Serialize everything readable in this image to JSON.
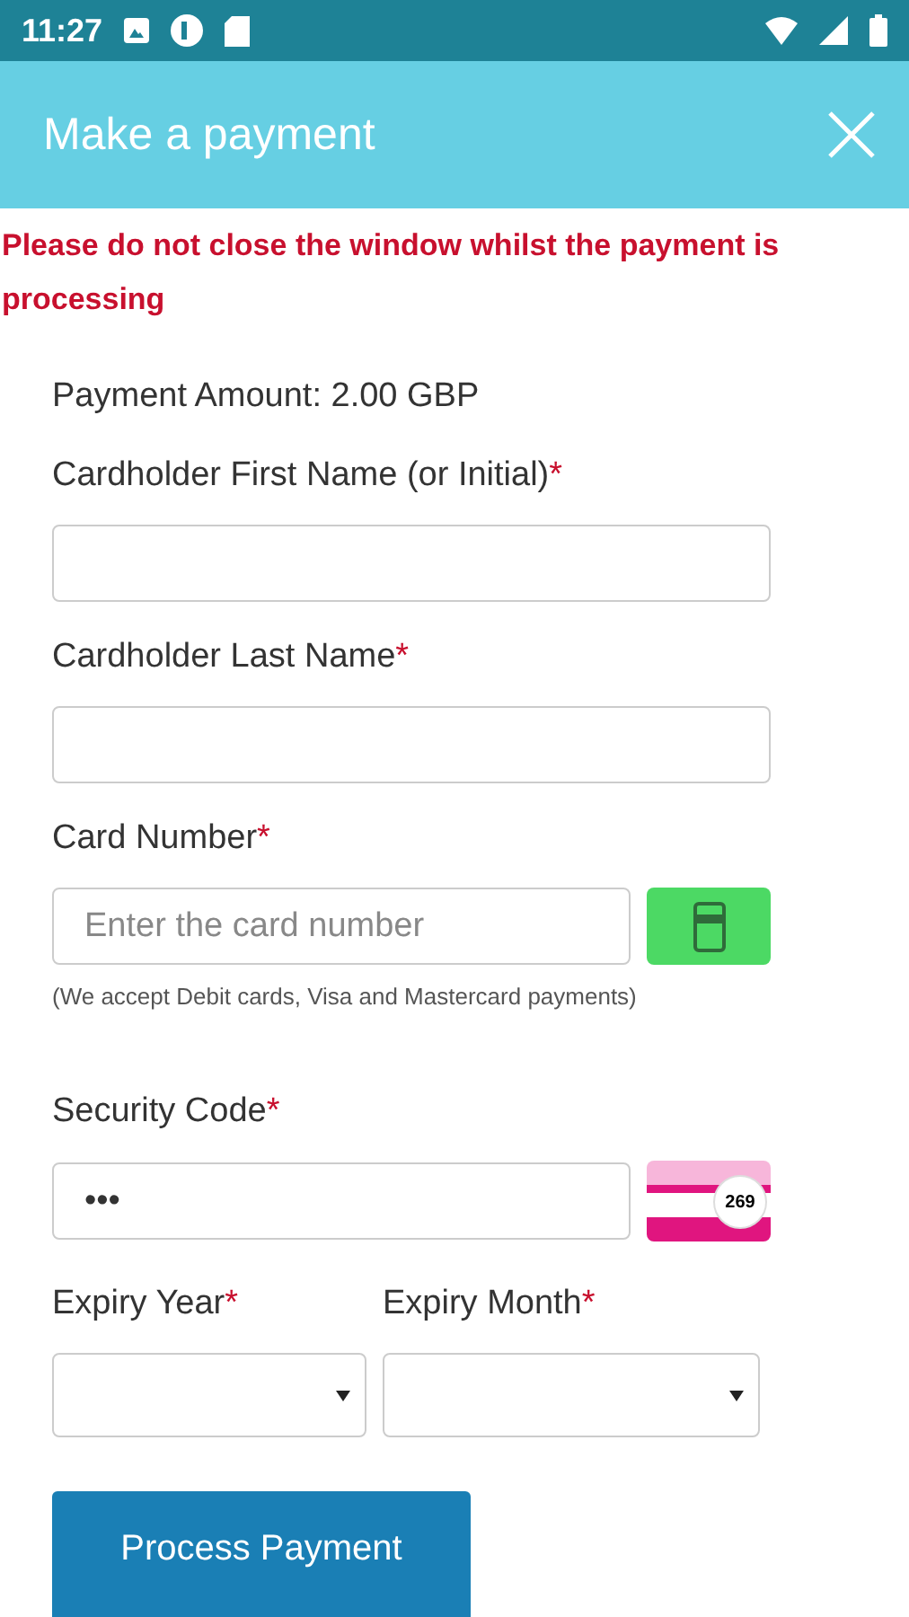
{
  "status_bar": {
    "time": "11:27"
  },
  "header": {
    "title": "Make a payment"
  },
  "warning": "Please do not close the window whilst the payment is processing",
  "amount": "Payment Amount: 2.00 GBP",
  "fields": [
    {
      "kind": "text",
      "label": "Cardholder First Name (or Initial)",
      "required_mark": "*"
    },
    {
      "kind": "text",
      "label": "Cardholder Last Name",
      "required_mark": "*"
    },
    {
      "kind": "card",
      "label": "Card Number",
      "required_mark": "*",
      "placeholder": "Enter the card number",
      "note": "(We accept Debit cards, Visa and Mastercard payments)"
    },
    {
      "kind": "cvv",
      "label": "Security Code",
      "required_mark": "*",
      "placeholder": "•••",
      "cvv_hint": "269"
    }
  ],
  "expiry": [
    {
      "label": "Expiry Year",
      "required_mark": "*"
    },
    {
      "label": "Expiry Month",
      "required_mark": "*"
    }
  ],
  "submit": "Process Payment"
}
